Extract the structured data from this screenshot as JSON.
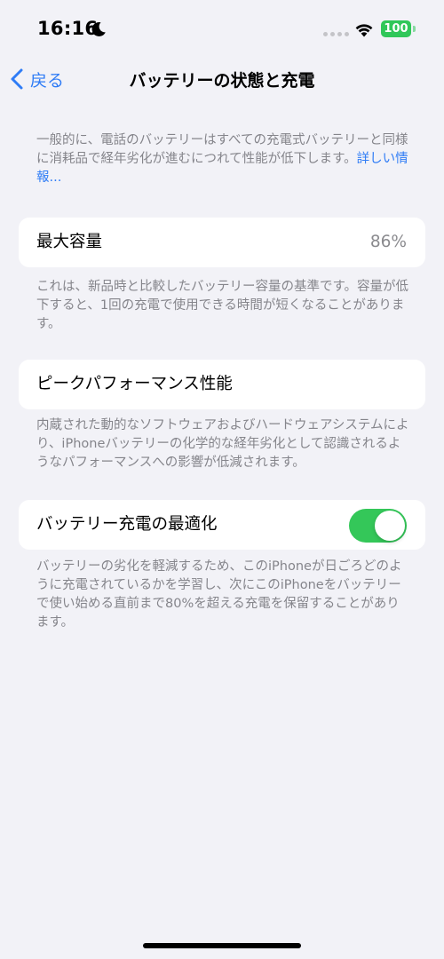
{
  "status_bar": {
    "time": "16:16",
    "battery_level": "100",
    "icons": [
      "moon-icon",
      "cellular-dots-icon",
      "wifi-icon",
      "battery-icon"
    ],
    "battery_color": "#30c759"
  },
  "nav": {
    "back_label": "戻る",
    "title": "バッテリーの状態と充電",
    "accent_color": "#2f7cf6"
  },
  "intro": {
    "text": "一般的に、電話のバッテリーはすべての充電式バッテリーと同様に消耗品で経年劣化が進むにつれて性能が低下します。",
    "link": "詳しい情報..."
  },
  "max_capacity": {
    "label": "最大容量",
    "value": "86%",
    "footnote": "これは、新品時と比較したバッテリー容量の基準です。容量が低下すると、1回の充電で使用できる時間が短くなることがあります。"
  },
  "peak_performance": {
    "label": "ピークパフォーマンス性能",
    "footnote": "内蔵された動的なソフトウェアおよびハードウェアシステムにより、iPhoneバッテリーの化学的な経年劣化として認識されるようなパフォーマンスへの影響が低減されます。"
  },
  "optimized_charging": {
    "label": "バッテリー充電の最適化",
    "enabled": true,
    "toggle_color": "#34c759",
    "footnote": "バッテリーの劣化を軽減するため、このiPhoneが日ごろどのように充電されているかを学習し、次にこのiPhoneをバッテリーで使い始める直前まで80%を超える充電を保留することがあります。"
  }
}
